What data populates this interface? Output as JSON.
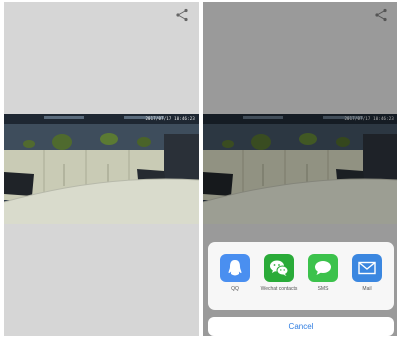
{
  "timestamp": "2017/07/17 10:46:23",
  "share_sheet": {
    "apps": [
      {
        "label": "QQ",
        "icon": "qq-icon",
        "color": "#4a8ff0"
      },
      {
        "label": "Wechat contacts",
        "icon": "wechat-icon",
        "color": "#2aab39"
      },
      {
        "label": "SMS",
        "icon": "sms-icon",
        "color": "#3cc24c"
      },
      {
        "label": "Mail",
        "icon": "mail-icon",
        "color": "#3b87e0"
      }
    ],
    "cancel_label": "Cancel"
  },
  "colors": {
    "screen_bg": "#d6d6d6",
    "accent": "#2f7de1",
    "sheet_bg": "#f7f7f7"
  }
}
